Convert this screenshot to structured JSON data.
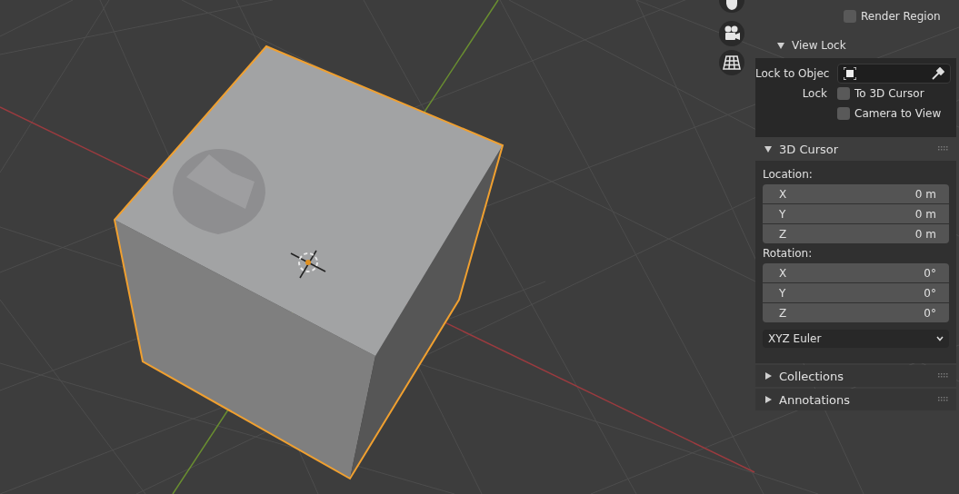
{
  "render_region": {
    "label": "Render Region",
    "checked": false
  },
  "view_lock": {
    "title": "View Lock",
    "expanded": true,
    "lock_to_object_label": "Lock to Objec",
    "lock_label": "Lock",
    "options": [
      {
        "label": "To 3D Cursor",
        "checked": false
      },
      {
        "label": "Camera to View",
        "checked": false
      }
    ]
  },
  "cursor_panel": {
    "title": "3D Cursor",
    "expanded": true,
    "location_label": "Location:",
    "location": [
      {
        "axis": "X",
        "value": "0 m"
      },
      {
        "axis": "Y",
        "value": "0 m"
      },
      {
        "axis": "Z",
        "value": "0 m"
      }
    ],
    "rotation_label": "Rotation:",
    "rotation": [
      {
        "axis": "X",
        "value": "0°"
      },
      {
        "axis": "Y",
        "value": "0°"
      },
      {
        "axis": "Z",
        "value": "0°"
      }
    ],
    "rotation_mode": "XYZ Euler"
  },
  "panels": [
    {
      "title": "Collections",
      "expanded": false
    },
    {
      "title": "Annotations",
      "expanded": false
    }
  ]
}
